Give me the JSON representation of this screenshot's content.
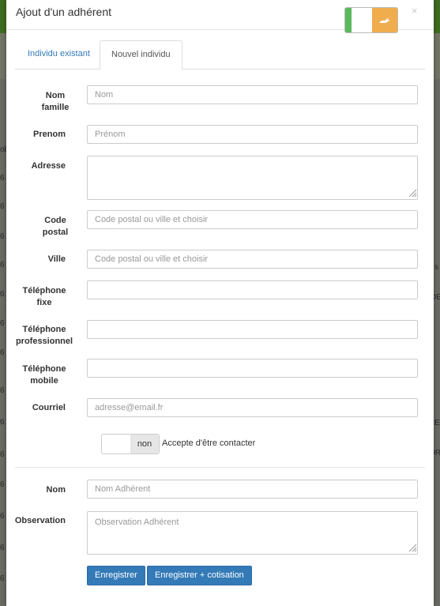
{
  "modal": {
    "title": "Ajout d'un adhérent",
    "close": "×"
  },
  "tabs": [
    "Individu existant",
    "Nouvel individu"
  ],
  "form": {
    "nom_famille": {
      "label1": "Nom",
      "label2": "famille",
      "placeholder": "Nom"
    },
    "prenom": {
      "label": "Prenom",
      "placeholder": "Prénom"
    },
    "adresse": {
      "label": "Adresse",
      "placeholder": ""
    },
    "code_postal": {
      "label1": "Code",
      "label2": "postal",
      "placeholder": "Code postal ou ville et choisir"
    },
    "ville": {
      "label": "Ville",
      "placeholder": "Code postal ou ville et choisir"
    },
    "tel_fixe": {
      "label1": "Téléphone",
      "label2": "fixe",
      "placeholder": ""
    },
    "tel_pro": {
      "label1": "Téléphone",
      "label2": "professionnel",
      "placeholder": ""
    },
    "tel_mobile": {
      "label1": "Téléphone",
      "label2": "mobile",
      "placeholder": ""
    },
    "courriel": {
      "label": "Courriel",
      "placeholder": "adresse@email.fr"
    },
    "contact_toggle": {
      "state": "non",
      "label": "Accepte d'être contacter"
    },
    "nom_adherent": {
      "label": "Nom",
      "placeholder": "Nom Adhérent"
    },
    "observation": {
      "label": "Observation",
      "placeholder": "Observation Adhérent"
    }
  },
  "buttons": {
    "save": "Enregistrer",
    "save_cotisation": "Enregistrer + cotisation"
  },
  "background_fragments": [
    "ob",
    "6",
    "6",
    "6",
    "6",
    "6",
    "s",
    "DES",
    "6",
    "6",
    "6",
    "6",
    "6",
    "HE",
    "ORE",
    "6",
    "6",
    "6",
    "6"
  ],
  "colors": {
    "primary": "#337ab7",
    "flag_green": "#5cb85c",
    "flag_orange": "#f0ad4e",
    "header_green": "#3f6b22"
  }
}
